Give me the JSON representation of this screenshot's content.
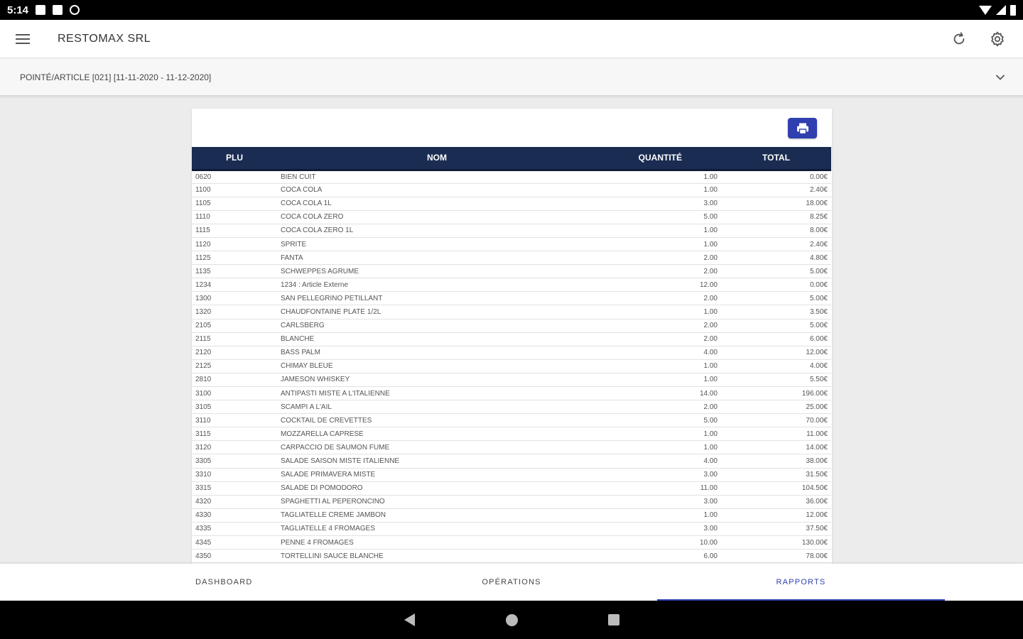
{
  "status_bar": {
    "time": "5:14"
  },
  "app_bar": {
    "title": "RESTOMAX SRL"
  },
  "filter": {
    "label": "POINTÉ/ARTICLE [021] [11-11-2020 - 11-12-2020]"
  },
  "table": {
    "headers": {
      "plu": "PLU",
      "nom": "NOM",
      "quantite": "QUANTITÉ",
      "total": "TOTAL"
    },
    "rows": [
      {
        "plu": "0620",
        "nom": "BIEN CUIT",
        "qty": "1.00",
        "total": "0.00€"
      },
      {
        "plu": "1100",
        "nom": "COCA COLA",
        "qty": "1.00",
        "total": "2.40€"
      },
      {
        "plu": "1105",
        "nom": "COCA COLA 1L",
        "qty": "3.00",
        "total": "18.00€"
      },
      {
        "plu": "1110",
        "nom": "COCA COLA ZERO",
        "qty": "5.00",
        "total": "8.25€"
      },
      {
        "plu": "1115",
        "nom": "COCA COLA ZERO 1L",
        "qty": "1.00",
        "total": "8.00€"
      },
      {
        "plu": "1120",
        "nom": "SPRITE",
        "qty": "1.00",
        "total": "2.40€"
      },
      {
        "plu": "1125",
        "nom": "FANTA",
        "qty": "2.00",
        "total": "4.80€"
      },
      {
        "plu": "1135",
        "nom": "SCHWEPPES AGRUME",
        "qty": "2.00",
        "total": "5.00€"
      },
      {
        "plu": "1234",
        "nom": "1234 : Article Externe",
        "qty": "12.00",
        "total": "0.00€"
      },
      {
        "plu": "1300",
        "nom": "SAN PELLEGRINO PETILLANT",
        "qty": "2.00",
        "total": "5.00€"
      },
      {
        "plu": "1320",
        "nom": "CHAUDFONTAINE PLATE 1/2L",
        "qty": "1.00",
        "total": "3.50€"
      },
      {
        "plu": "2105",
        "nom": "CARLSBERG",
        "qty": "2.00",
        "total": "5.00€"
      },
      {
        "plu": "2115",
        "nom": "BLANCHE",
        "qty": "2.00",
        "total": "6.00€"
      },
      {
        "plu": "2120",
        "nom": "BASS PALM",
        "qty": "4.00",
        "total": "12.00€"
      },
      {
        "plu": "2125",
        "nom": "CHIMAY BLEUE",
        "qty": "1.00",
        "total": "4.00€"
      },
      {
        "plu": "2810",
        "nom": "JAMESON WHISKEY",
        "qty": "1.00",
        "total": "5.50€"
      },
      {
        "plu": "3100",
        "nom": "ANTIPASTI MISTE A L'ITALIENNE",
        "qty": "14.00",
        "total": "196.00€"
      },
      {
        "plu": "3105",
        "nom": "SCAMPI A L'AIL",
        "qty": "2.00",
        "total": "25.00€"
      },
      {
        "plu": "3110",
        "nom": "COCKTAIL DE CREVETTES",
        "qty": "5.00",
        "total": "70.00€"
      },
      {
        "plu": "3115",
        "nom": "MOZZARELLA CAPRESE",
        "qty": "1.00",
        "total": "11.00€"
      },
      {
        "plu": "3120",
        "nom": "CARPACCIO DE SAUMON FUME",
        "qty": "1.00",
        "total": "14.00€"
      },
      {
        "plu": "3305",
        "nom": "SALADE SAISON MISTE ITALIENNE",
        "qty": "4.00",
        "total": "38.00€"
      },
      {
        "plu": "3310",
        "nom": "SALADE PRIMAVERA MISTE",
        "qty": "3.00",
        "total": "31.50€"
      },
      {
        "plu": "3315",
        "nom": "SALADE DI POMODORO",
        "qty": "11.00",
        "total": "104.50€"
      },
      {
        "plu": "4320",
        "nom": "SPAGHETTI AL PEPERONCINO",
        "qty": "3.00",
        "total": "36.00€"
      },
      {
        "plu": "4330",
        "nom": "TAGLIATELLE CREME JAMBON",
        "qty": "1.00",
        "total": "12.00€"
      },
      {
        "plu": "4335",
        "nom": "TAGLIATELLE 4 FROMAGES",
        "qty": "3.00",
        "total": "37.50€"
      },
      {
        "plu": "4345",
        "nom": "PENNE 4 FROMAGES",
        "qty": "10.00",
        "total": "130.00€"
      },
      {
        "plu": "4350",
        "nom": "TORTELLINI SAUCE BLANCHE",
        "qty": "6.00",
        "total": "78.00€"
      }
    ]
  },
  "bottom_nav": {
    "tabs": [
      "DASHBOARD",
      "OPÉRATIONS",
      "RAPPORTS"
    ],
    "active": 2
  },
  "colors": {
    "accent": "#2f3fb0",
    "table_header": "#1b2c52"
  }
}
